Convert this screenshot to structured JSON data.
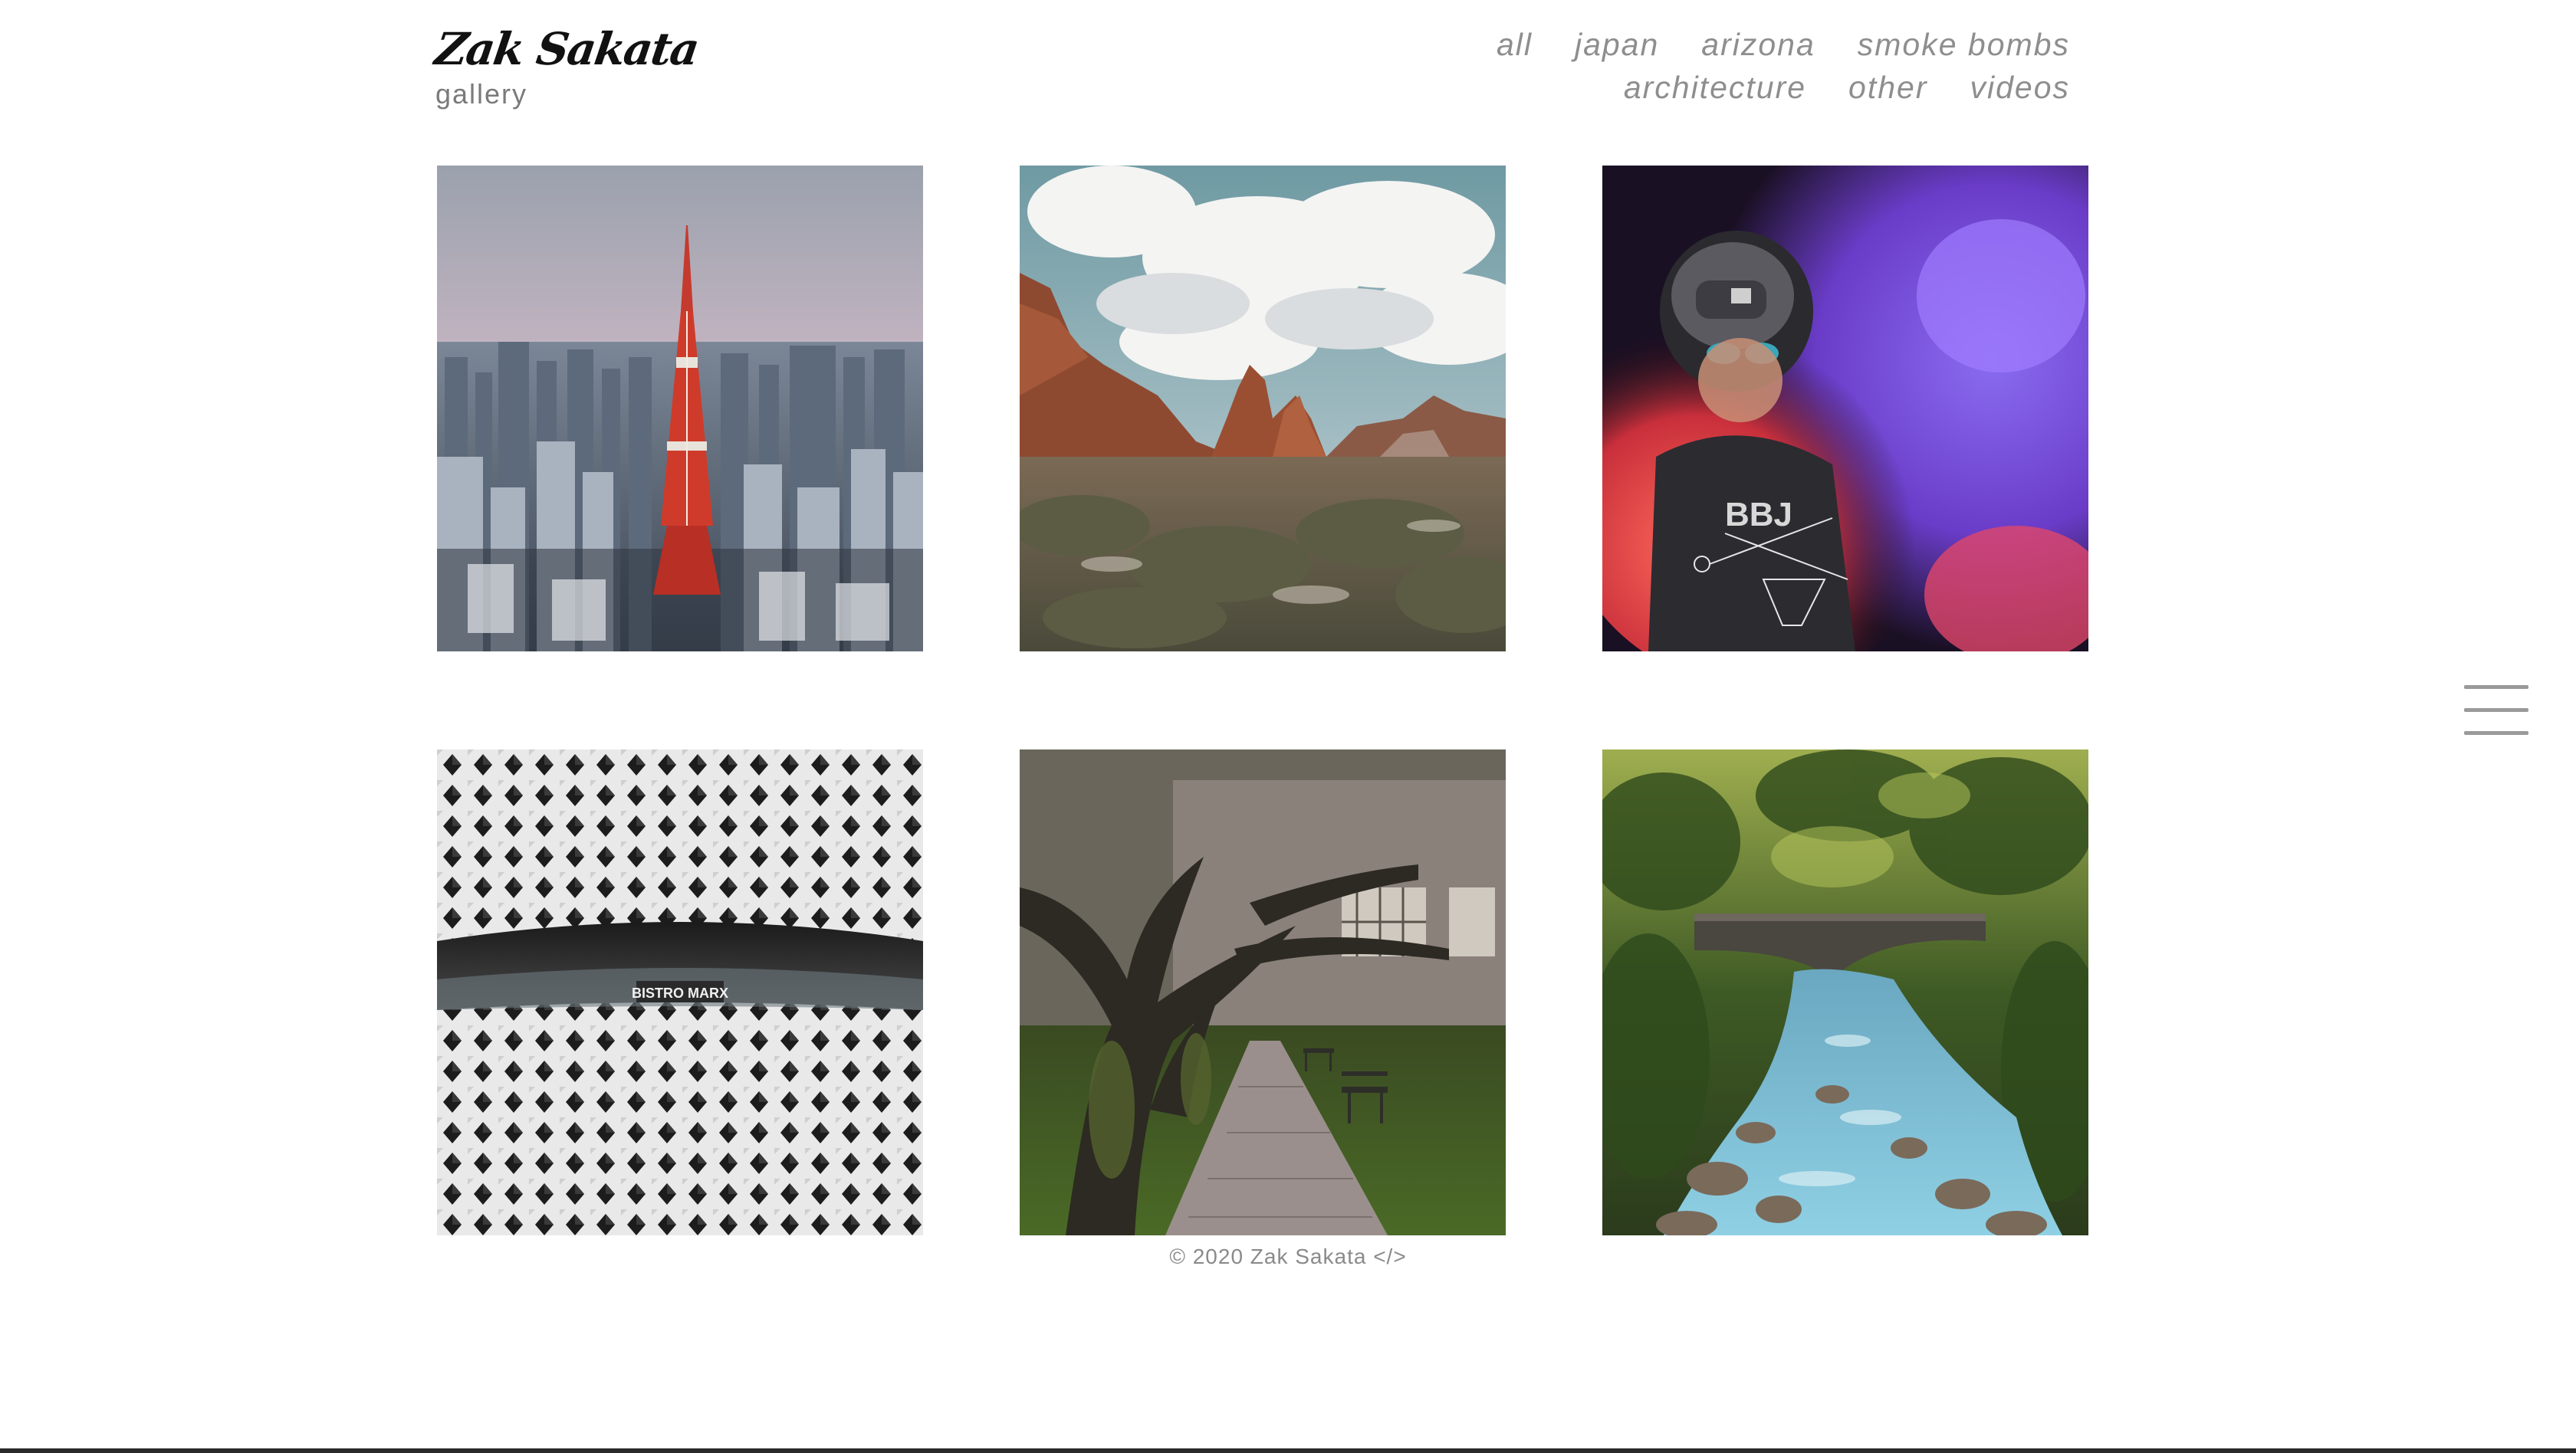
{
  "brand": {
    "title": "Zak Sakata",
    "subtitle": "gallery"
  },
  "nav": {
    "row1": [
      "all",
      "japan",
      "arizona",
      "smoke bombs"
    ],
    "row2": [
      "architecture",
      "other",
      "videos"
    ]
  },
  "gallery": {
    "tiles": [
      {
        "subject": "tokyo-tower-cityscape"
      },
      {
        "subject": "arizona-red-rocks"
      },
      {
        "subject": "smoke-bomb-portrait"
      },
      {
        "subject": "bistro-facade-architecture",
        "sign_text": "BISTRO MARX"
      },
      {
        "subject": "campus-brick-path"
      },
      {
        "subject": "forest-river-bridge"
      }
    ]
  },
  "footer": {
    "text": "© 2020 Zak Sakata </>"
  },
  "menu": {
    "icon": "hamburger-menu-icon"
  },
  "colors": {
    "nav_text": "#8e8e8e",
    "brand_text": "#111111",
    "subtitle_text": "#7a7a7a",
    "footer_text": "#8a8a8a",
    "menu_icon": "#9a9a9a"
  }
}
